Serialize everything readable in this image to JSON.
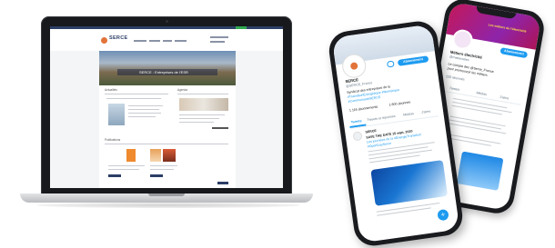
{
  "laptop": {
    "site": {
      "logo_text": "SERCE",
      "hero_text": "SERCE : Entreprises de l'ESR",
      "section_left": "Actualités",
      "section_right": "Agenda",
      "section_bottom": "Publications"
    }
  },
  "phone_front": {
    "profile_name": "SERCE",
    "handle": "@SERCE_France",
    "follow_label": "Abonnement",
    "bio_1": "Syndicat des entreprises de la",
    "bio_2": "#TransitionÉnergétique #Numérique",
    "bio_3": "#CommunautéSERCE",
    "following": "1 116 abonnements",
    "followers": "1 800 abonnés",
    "tab_tweets": "Tweets",
    "tab_replies": "Tweets et réponses",
    "tab_media": "Médias",
    "tab_likes": "J'aime",
    "tweet_author": "SERCE",
    "tweet_line_1": "SAVE THE DATE 15 sept. 2020",
    "tweet_line_2": "Les journées de la #ÉnergieTransition",
    "tweet_line_3": "#OpenDaySerce",
    "fab_icon": "+"
  },
  "phone_back": {
    "banner_text": "Les métiers de l'électricité",
    "title": "Métiers électricité",
    "handle": "@metierselec",
    "follow_label": "Abonnement",
    "bio_1": "Le compte des @Serce_France",
    "bio_2": "pour promouvoir les métiers",
    "stat": "233 abonnés",
    "tab_tweets": "Tweets",
    "tab_media": "Médias",
    "tab_likes": "J'aime"
  },
  "colors": {
    "twitter_blue": "#1d9bf0",
    "serce_navy": "#2c3e66",
    "serce_orange": "#ef8a2e",
    "banner_magenta": "#c2185b"
  }
}
